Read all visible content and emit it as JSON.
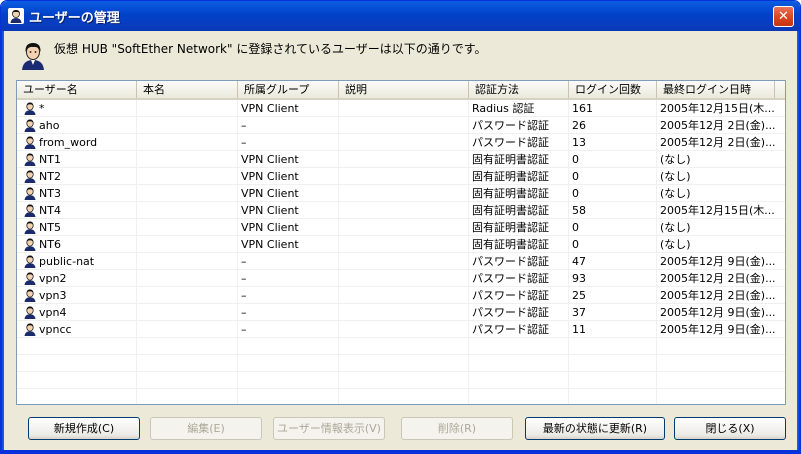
{
  "window": {
    "title": "ユーザーの管理",
    "close_label": "✕"
  },
  "description": "仮想 HUB \"SoftEther Network\" に登録されているユーザーは以下の通りです。",
  "columns": [
    "ユーザー名",
    "本名",
    "所属グループ",
    "説明",
    "認証方法",
    "ログイン回数",
    "最終ログイン日時"
  ],
  "users": [
    [
      "*",
      "",
      "VPN Client",
      "",
      "Radius 認証",
      "161",
      "2005年12月15日(木..."
    ],
    [
      "aho",
      "",
      "–",
      "",
      "パスワード認証",
      "26",
      "2005年12月 2日(金)..."
    ],
    [
      "from_word",
      "",
      "–",
      "",
      "パスワード認証",
      "13",
      "2005年12月 2日(金)..."
    ],
    [
      "NT1",
      "",
      "VPN Client",
      "",
      "固有証明書認証",
      "0",
      "(なし)"
    ],
    [
      "NT2",
      "",
      "VPN Client",
      "",
      "固有証明書認証",
      "0",
      "(なし)"
    ],
    [
      "NT3",
      "",
      "VPN Client",
      "",
      "固有証明書認証",
      "0",
      "(なし)"
    ],
    [
      "NT4",
      "",
      "VPN Client",
      "",
      "固有証明書認証",
      "58",
      "2005年12月15日(木..."
    ],
    [
      "NT5",
      "",
      "VPN Client",
      "",
      "固有証明書認証",
      "0",
      "(なし)"
    ],
    [
      "NT6",
      "",
      "VPN Client",
      "",
      "固有証明書認証",
      "0",
      "(なし)"
    ],
    [
      "public-nat",
      "",
      "–",
      "",
      "パスワード認証",
      "47",
      "2005年12月 9日(金)..."
    ],
    [
      "vpn2",
      "",
      "–",
      "",
      "パスワード認証",
      "93",
      "2005年12月 2日(金)..."
    ],
    [
      "vpn3",
      "",
      "–",
      "",
      "パスワード認証",
      "25",
      "2005年12月 2日(金)..."
    ],
    [
      "vpn4",
      "",
      "–",
      "",
      "パスワード認証",
      "37",
      "2005年12月 9日(金)..."
    ],
    [
      "vpncc",
      "",
      "–",
      "",
      "パスワード認証",
      "11",
      "2005年12月 9日(金)..."
    ]
  ],
  "buttons": {
    "new": "新規作成(C)",
    "edit": "編集(E)",
    "info": "ユーザー情報表示(V)",
    "delete": "削除(R)",
    "refresh": "最新の状態に更新(R)",
    "close": "閉じる(X)"
  }
}
